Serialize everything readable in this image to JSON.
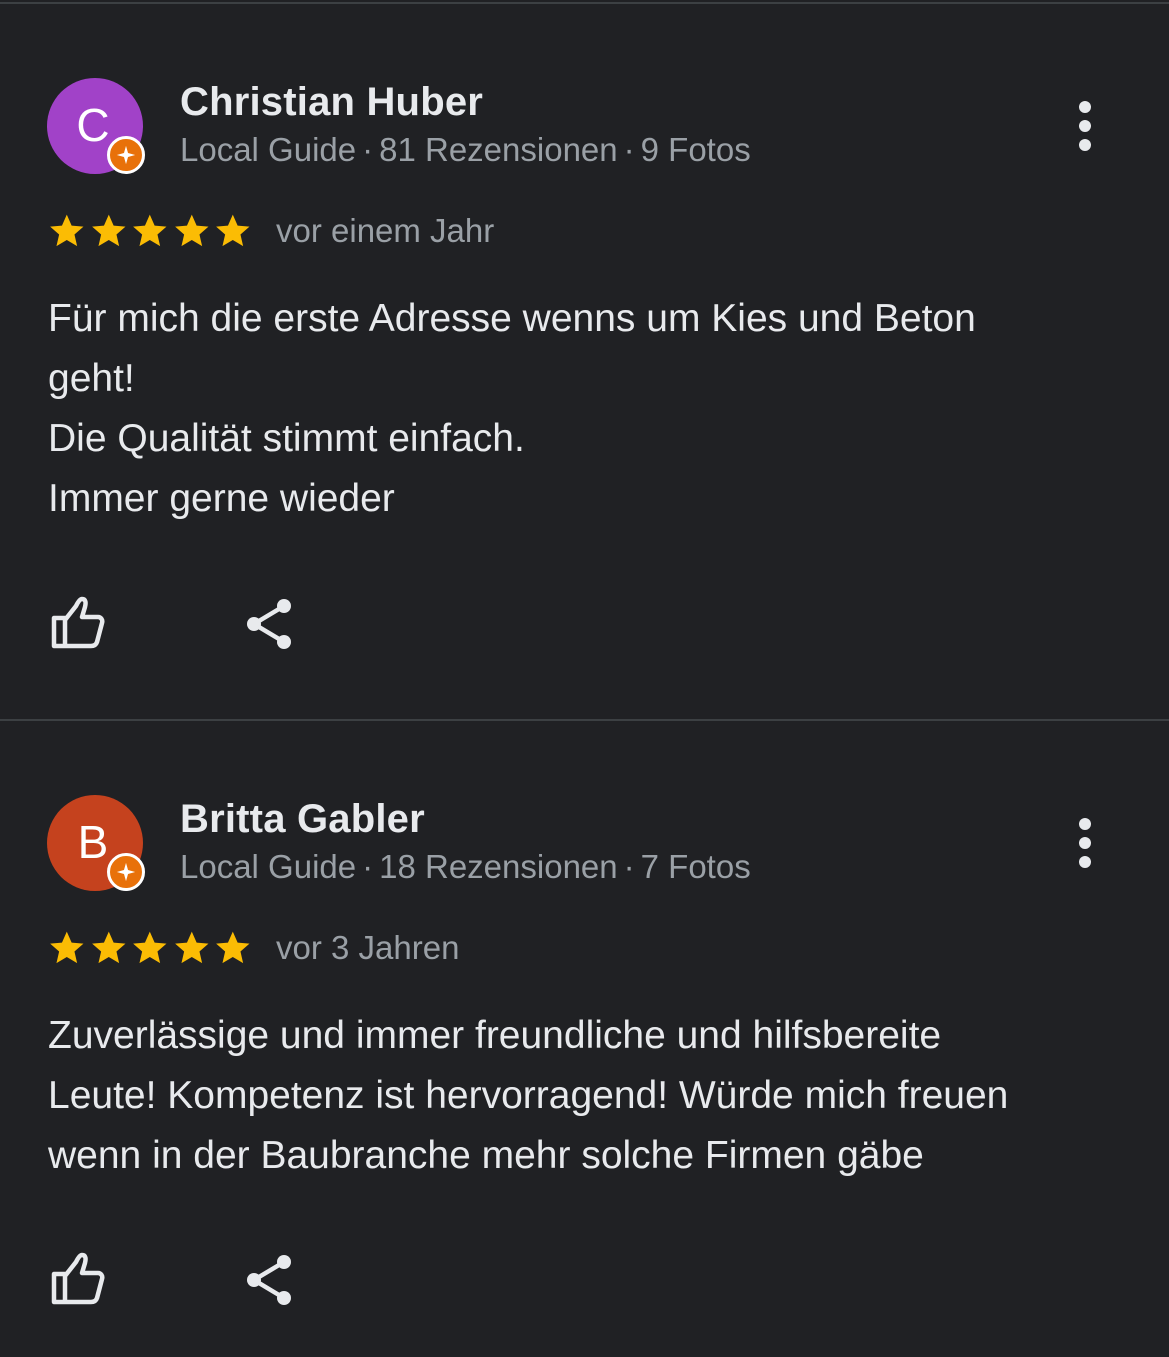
{
  "reviews": [
    {
      "avatar_letter": "C",
      "avatar_color": "#a142c8",
      "name": "Christian Huber",
      "guide_label": "Local Guide",
      "reviews_count": "81 Rezensionen",
      "photos_count": "9 Fotos",
      "rating": 5,
      "date": "vor einem Jahr",
      "text_lines": [
        "Für mich die erste Adresse wenns um Kies und Beton",
        "geht!",
        "Die Qualität stimmt einfach.",
        "Immer gerne wieder"
      ]
    },
    {
      "avatar_letter": "B",
      "avatar_color": "#c5421e",
      "name": "Britta Gabler",
      "guide_label": "Local Guide",
      "reviews_count": "18 Rezensionen",
      "photos_count": "7 Fotos",
      "rating": 5,
      "date": "vor 3 Jahren",
      "text_lines": [
        "Zuverlässige und immer freundliche und hilfsbereite",
        "Leute! Kompetenz ist hervorragend! Würde mich freuen",
        "wenn in der Baubranche mehr solche Firmen gäbe"
      ]
    }
  ],
  "separator": "·",
  "colors": {
    "background": "#202124",
    "star": "#fbbc04",
    "badge": "#e8710a",
    "secondary_text": "#9aa0a6"
  }
}
